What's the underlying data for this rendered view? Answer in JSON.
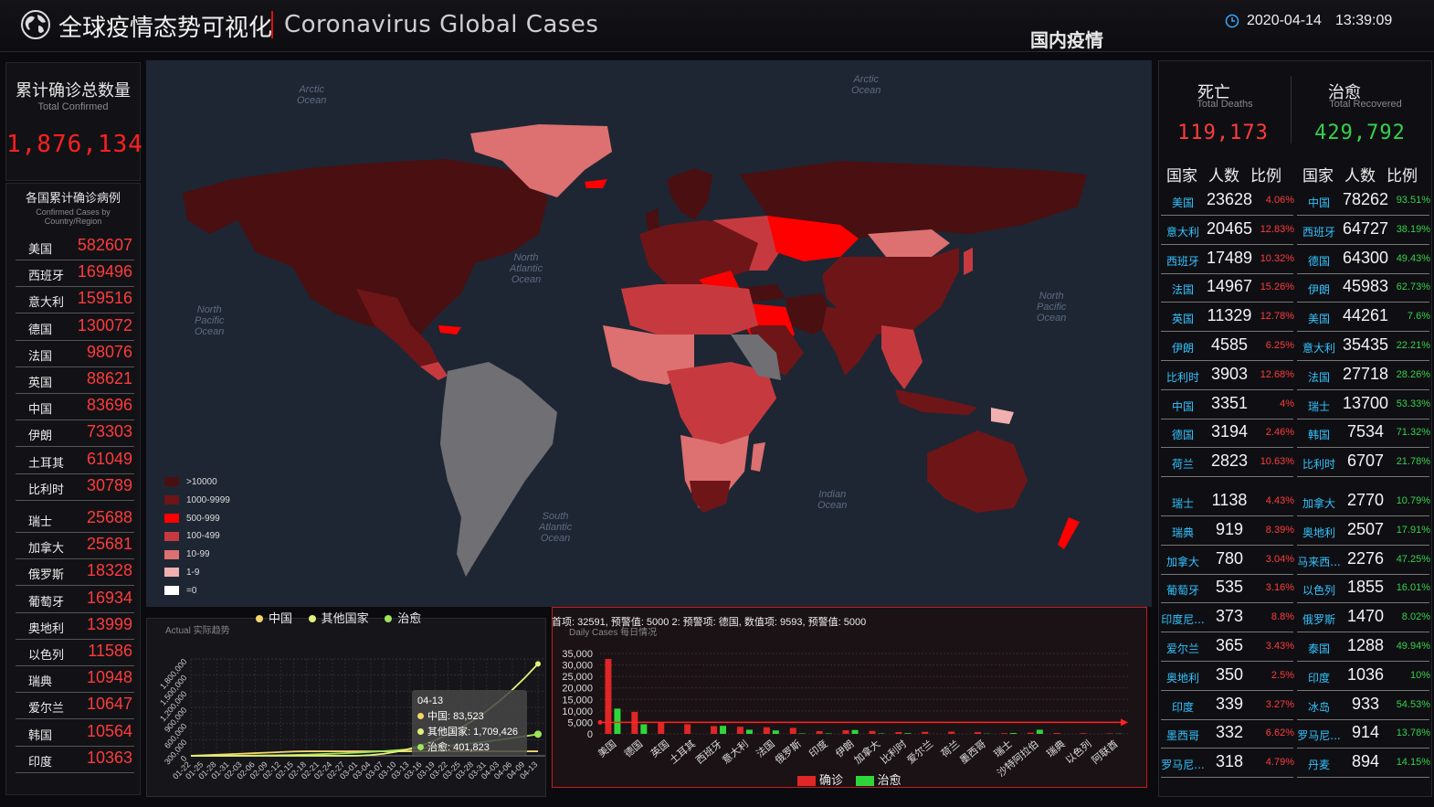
{
  "header": {
    "title_cn": "全球疫情态势可视化",
    "title_en": "Coronavirus Global Cases",
    "domestic_link": "国内疫情",
    "date": "2020-04-14",
    "time": "13:39:09"
  },
  "left": {
    "total_title": "累计确诊总数量",
    "total_sub": "Total Confirmed",
    "total_value": "1,876,134",
    "list_title": "各国累计确诊病例",
    "list_sub": "Confirmed Cases by Country/Region",
    "countries": [
      {
        "name": "美国",
        "value": "582607"
      },
      {
        "name": "西班牙",
        "value": "169496"
      },
      {
        "name": "意大利",
        "value": "159516"
      },
      {
        "name": "德国",
        "value": "130072"
      },
      {
        "name": "法国",
        "value": "98076"
      },
      {
        "name": "英国",
        "value": "88621"
      },
      {
        "name": "中国",
        "value": "83696"
      },
      {
        "name": "伊朗",
        "value": "73303"
      },
      {
        "name": "土耳其",
        "value": "61049"
      },
      {
        "name": "比利时",
        "value": "30789"
      },
      {
        "name": "瑞士",
        "value": "25688"
      },
      {
        "name": "加拿大",
        "value": "25681"
      },
      {
        "name": "俄罗斯",
        "value": "18328"
      },
      {
        "name": "葡萄牙",
        "value": "16934"
      },
      {
        "name": "奥地利",
        "value": "13999"
      },
      {
        "name": "以色列",
        "value": "11586"
      },
      {
        "name": "瑞典",
        "value": "10948"
      },
      {
        "name": "爱尔兰",
        "value": "10647"
      },
      {
        "name": "韩国",
        "value": "10564"
      },
      {
        "name": "印度",
        "value": "10363"
      }
    ]
  },
  "map": {
    "oceans": [
      {
        "name": "Arctic Ocean",
        "l1": "Arctic",
        "l2": "Ocean"
      },
      {
        "name": "Arctic Ocean 2",
        "l1": "Arctic",
        "l2": "Ocean"
      },
      {
        "name": "North Atlantic Ocean",
        "l1": "North",
        "l2": "Atlantic",
        "l3": "Ocean"
      },
      {
        "name": "North Pacific Ocean",
        "l1": "North",
        "l2": "Pacific",
        "l3": "Ocean"
      },
      {
        "name": "North Pacific Ocean 2",
        "l1": "North",
        "l2": "Pacific",
        "l3": "Ocean"
      },
      {
        "name": "South Atlantic Ocean",
        "l1": "South",
        "l2": "Atlantic",
        "l3": "Ocean"
      },
      {
        "name": "Indian Ocean",
        "l1": "Indian",
        "l2": "Ocean"
      }
    ],
    "legend": [
      {
        "label": ">10000",
        "color": "#4a0f10"
      },
      {
        "label": "1000-9999",
        "color": "#6e1518"
      },
      {
        "label": "500-999",
        "color": "#ff0000"
      },
      {
        "label": "100-499",
        "color": "#c63a3f"
      },
      {
        "label": "10-99",
        "color": "#dd7070"
      },
      {
        "label": "1-9",
        "color": "#f0b0b0"
      },
      {
        "label": "=0",
        "color": "#ffffff"
      }
    ]
  },
  "trend": {
    "legend": [
      "中国",
      "其他国家",
      "治愈"
    ],
    "subtitle": "Actual 实际趋势",
    "y_ticks": [
      "1,800,000",
      "1,500,000",
      "1,200,000",
      "900,000",
      "600,000",
      "300,000",
      "0"
    ],
    "x_labels": [
      "01-22",
      "01-25",
      "01-28",
      "01-31",
      "02-03",
      "02-06",
      "02-09",
      "02-12",
      "02-15",
      "02-18",
      "02-21",
      "02-24",
      "02-27",
      "03-01",
      "03-04",
      "03-07",
      "03-10",
      "03-13",
      "03-16",
      "03-19",
      "03-22",
      "03-25",
      "03-28",
      "03-31",
      "04-03",
      "04-06",
      "04-09",
      "04-13"
    ],
    "tooltip": {
      "date": "04-13",
      "china": "中国: 83,523",
      "others": "其他国家: 1,709,426",
      "cured": "治愈: 401,823"
    }
  },
  "daily": {
    "marquee": "首项: 32591, 预警值: 5000  2: 预警项: 德国, 数值项: 9593, 预警值: 5000",
    "subtitle": "Daily Cases 每日情况",
    "y_ticks": [
      "35,000",
      "30,000",
      "25,000",
      "20,000",
      "15,000",
      "10,000",
      "5,000",
      "0"
    ],
    "legend_confirmed": "确诊",
    "legend_cured": "治愈"
  },
  "chart_data": {
    "type": "bar",
    "categories": [
      "美国",
      "德国",
      "英国",
      "土耳其",
      "西班牙",
      "意大利",
      "法国",
      "俄罗斯",
      "印度",
      "伊朗",
      "加拿大",
      "比利时",
      "爱尔兰",
      "荷兰",
      "墨西哥",
      "瑞士",
      "沙特阿拉伯",
      "瑞典",
      "以色列",
      "阿联酋"
    ],
    "series": [
      {
        "name": "确诊",
        "values": [
          32591,
          9593,
          5200,
          4200,
          3400,
          3100,
          2900,
          2600,
          1200,
          1600,
          1300,
          800,
          900,
          1000,
          800,
          300,
          500,
          400,
          300,
          200
        ]
      },
      {
        "name": "治愈",
        "values": [
          11000,
          4200,
          0,
          0,
          3500,
          1800,
          1500,
          200,
          200,
          1700,
          200,
          300,
          0,
          0,
          100,
          400,
          1800,
          0,
          0,
          100
        ]
      }
    ],
    "ylim": [
      0,
      35000
    ]
  },
  "right": {
    "deaths_title": "死亡",
    "deaths_sub": "Total Deaths",
    "deaths_value": "119,173",
    "recovered_title": "治愈",
    "recovered_sub": "Total Recovered",
    "recovered_value": "429,792",
    "headers": [
      "国家",
      "人数",
      "比例"
    ],
    "deaths_color": "#ff3b3b",
    "recovered_color": "#35d14a",
    "deaths": [
      {
        "name": "美国",
        "value": "23628",
        "pct": "4.06%"
      },
      {
        "name": "意大利",
        "value": "20465",
        "pct": "12.83%"
      },
      {
        "name": "西班牙",
        "value": "17489",
        "pct": "10.32%"
      },
      {
        "name": "法国",
        "value": "14967",
        "pct": "15.26%"
      },
      {
        "name": "英国",
        "value": "11329",
        "pct": "12.78%"
      },
      {
        "name": "伊朗",
        "value": "4585",
        "pct": "6.25%"
      },
      {
        "name": "比利时",
        "value": "3903",
        "pct": "12.68%"
      },
      {
        "name": "中国",
        "value": "3351",
        "pct": "4%"
      },
      {
        "name": "德国",
        "value": "3194",
        "pct": "2.46%"
      },
      {
        "name": "荷兰",
        "value": "2823",
        "pct": "10.63%"
      },
      {
        "name": "瑞士",
        "value": "1138",
        "pct": "4.43%"
      },
      {
        "name": "瑞典",
        "value": "919",
        "pct": "8.39%"
      },
      {
        "name": "加拿大",
        "value": "780",
        "pct": "3.04%"
      },
      {
        "name": "葡萄牙",
        "value": "535",
        "pct": "3.16%"
      },
      {
        "name": "印度尼...",
        "value": "373",
        "pct": "8.8%"
      },
      {
        "name": "爱尔兰",
        "value": "365",
        "pct": "3.43%"
      },
      {
        "name": "奥地利",
        "value": "350",
        "pct": "2.5%"
      },
      {
        "name": "印度",
        "value": "339",
        "pct": "3.27%"
      },
      {
        "name": "墨西哥",
        "value": "332",
        "pct": "6.62%"
      },
      {
        "name": "罗马尼...",
        "value": "318",
        "pct": "4.79%"
      }
    ],
    "recovered": [
      {
        "name": "中国",
        "value": "78262",
        "pct": "93.51%"
      },
      {
        "name": "西班牙",
        "value": "64727",
        "pct": "38.19%"
      },
      {
        "name": "德国",
        "value": "64300",
        "pct": "49.43%"
      },
      {
        "name": "伊朗",
        "value": "45983",
        "pct": "62.73%"
      },
      {
        "name": "美国",
        "value": "44261",
        "pct": "7.6%"
      },
      {
        "name": "意大利",
        "value": "35435",
        "pct": "22.21%"
      },
      {
        "name": "法国",
        "value": "27718",
        "pct": "28.26%"
      },
      {
        "name": "瑞士",
        "value": "13700",
        "pct": "53.33%"
      },
      {
        "name": "韩国",
        "value": "7534",
        "pct": "71.32%"
      },
      {
        "name": "比利时",
        "value": "6707",
        "pct": "21.78%"
      },
      {
        "name": "加拿大",
        "value": "2770",
        "pct": "10.79%"
      },
      {
        "name": "奥地利",
        "value": "2507",
        "pct": "17.91%"
      },
      {
        "name": "马来西...",
        "value": "2276",
        "pct": "47.25%"
      },
      {
        "name": "以色列",
        "value": "1855",
        "pct": "16.01%"
      },
      {
        "name": "俄罗斯",
        "value": "1470",
        "pct": "8.02%"
      },
      {
        "name": "泰国",
        "value": "1288",
        "pct": "49.94%"
      },
      {
        "name": "印度",
        "value": "1036",
        "pct": "10%"
      },
      {
        "name": "冰岛",
        "value": "933",
        "pct": "54.53%"
      },
      {
        "name": "罗马尼...",
        "value": "914",
        "pct": "13.78%"
      },
      {
        "name": "丹麦",
        "value": "894",
        "pct": "14.15%"
      }
    ]
  }
}
